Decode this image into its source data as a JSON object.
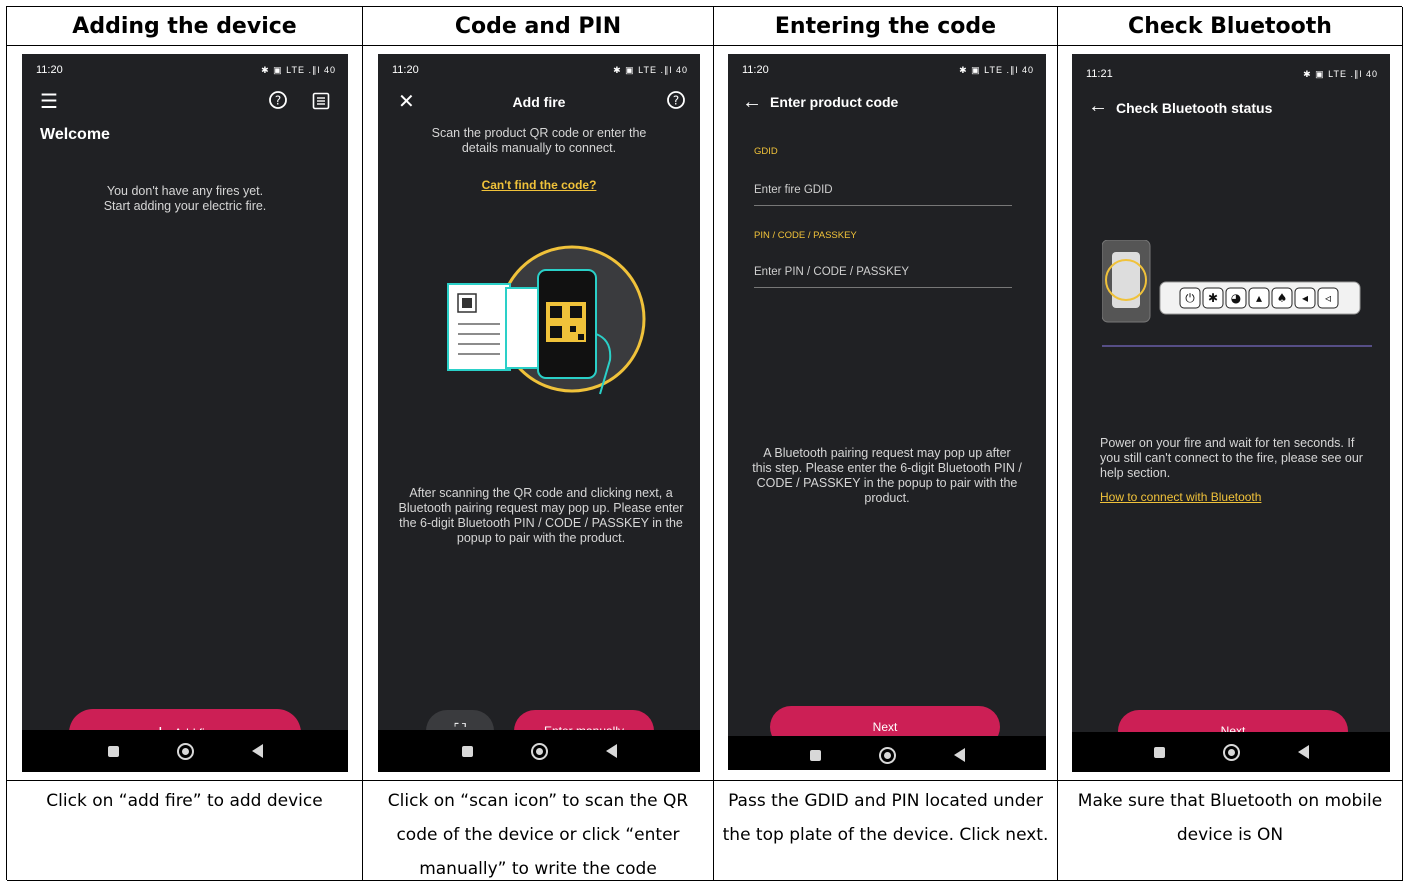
{
  "headers": [
    "Adding the device",
    "Code and PIN",
    "Entering the code",
    "Check Bluetooth"
  ],
  "captions": [
    "Click on “add fire” to add device",
    "Click on “scan icon” to scan the QR code of the device or click “enter manually” to write the code",
    "Pass the GDID and PIN located under the top plate of the device. Click next.",
    "Make sure that Bluetooth on mobile device is ON"
  ],
  "screen1": {
    "time": "11:20",
    "status_icons": "✱ ▣ LTE .∥l 40",
    "title": "Welcome",
    "empty_line1": "You don't have any fires yet.",
    "empty_line2": "Start adding your electric fire.",
    "add_label": "Add fire"
  },
  "screen2": {
    "time": "11:20",
    "title": "Add fire",
    "intro": "Scan the product QR code or enter the details manually to connect.",
    "link": "Can't find the code?",
    "after": "After scanning the QR code and clicking next, a Bluetooth pairing request may pop up.  Please enter the 6-digit Bluetooth PIN / CODE / PASSKEY in the popup to pair with the product.",
    "manual_label": "Enter manually"
  },
  "screen3": {
    "time": "11:20",
    "title": "Enter product code",
    "gdid_label": "GDID",
    "gdid_placeholder": "Enter fire GDID",
    "pin_label": "PIN / CODE / PASSKEY",
    "pin_placeholder": "Enter PIN / CODE / PASSKEY",
    "note": "A Bluetooth pairing request may pop up after this step.  Please enter the 6-digit Bluetooth PIN / CODE / PASSKEY in the popup to pair with the product.",
    "next_label": "Next"
  },
  "screen4": {
    "time": "11:21",
    "title": "Check Bluetooth status",
    "body": "Power on your fire and wait for ten seconds. If you still can't connect to the fire, please see our help section.",
    "link": "How to connect with Bluetooth",
    "next_label": "Next"
  },
  "colors": {
    "accent": "#cc1f55",
    "screen_bg": "#202124",
    "link": "#f0c23a",
    "teal": "#2ad0c8"
  }
}
